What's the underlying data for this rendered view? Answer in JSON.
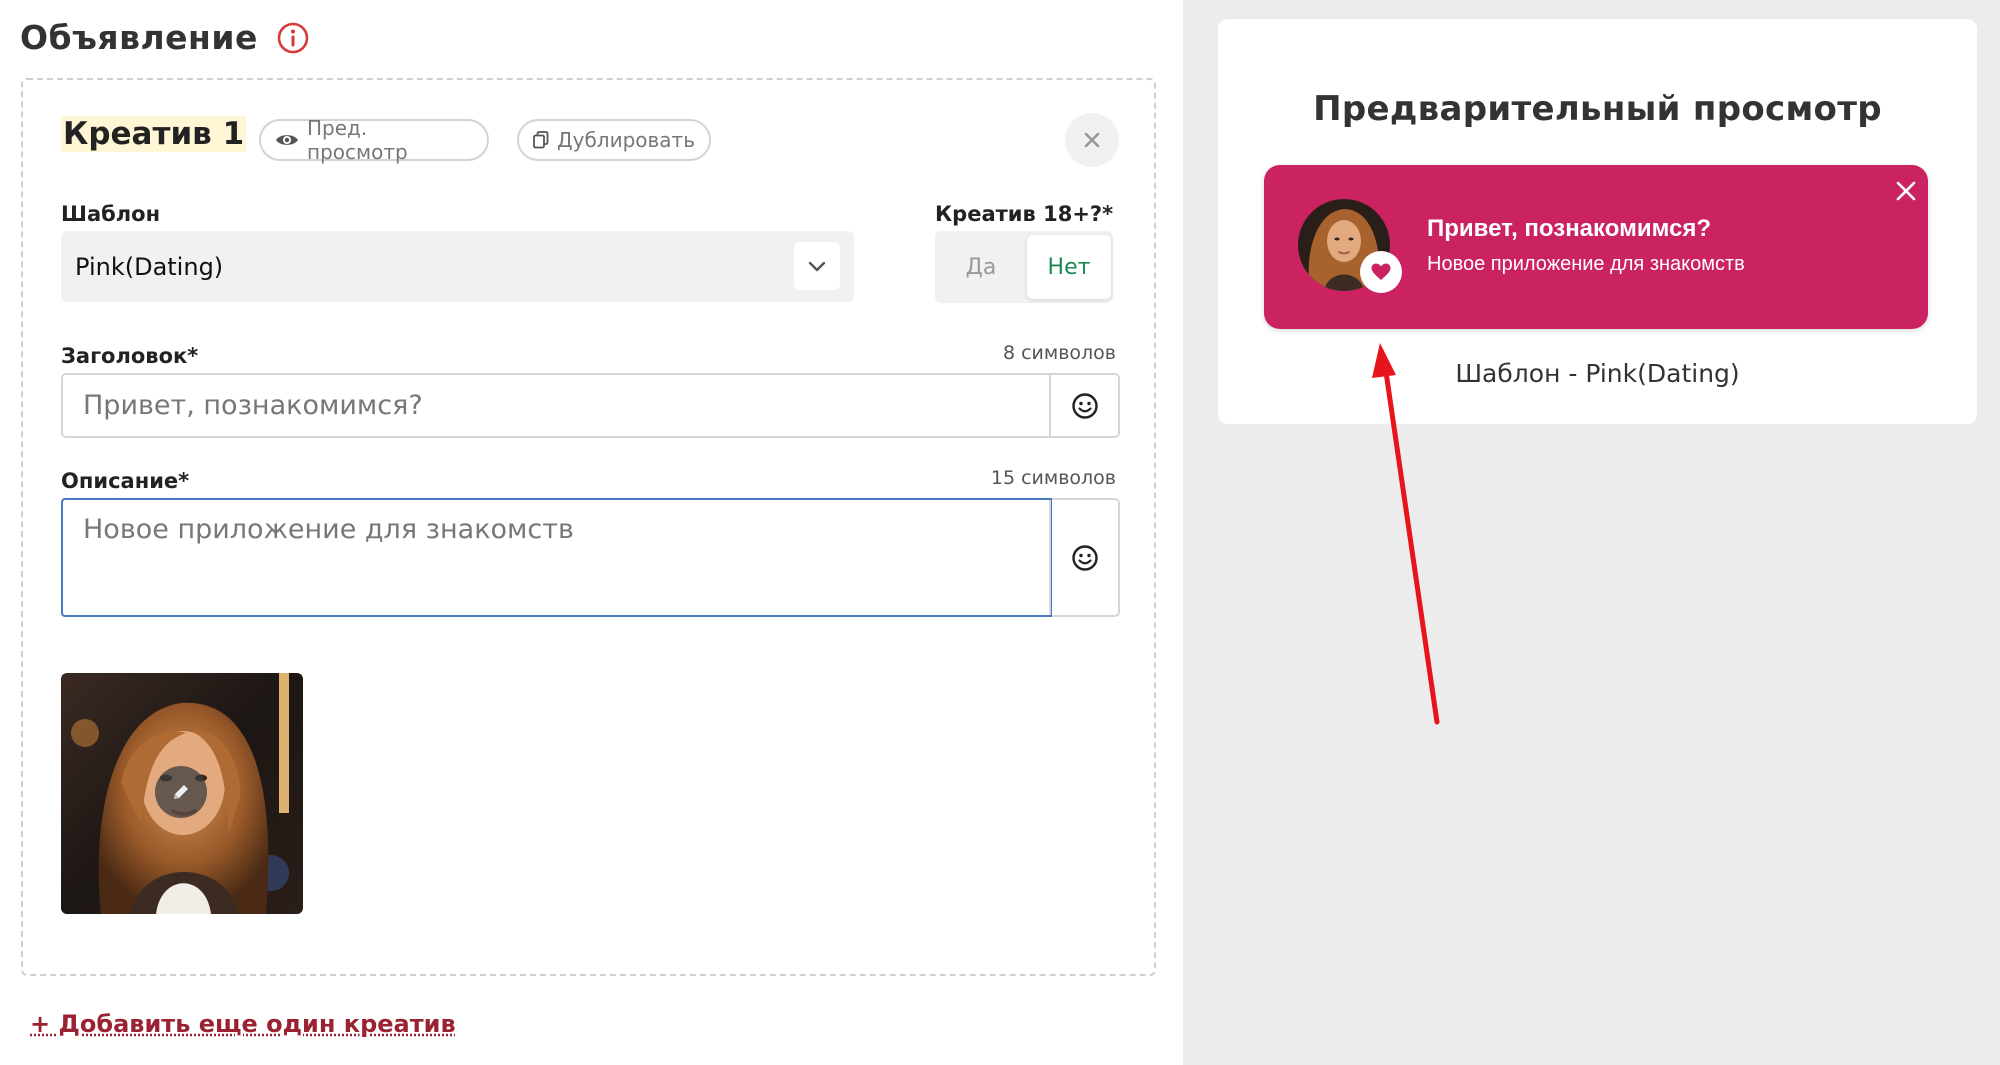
{
  "ad": {
    "title": "Объявление"
  },
  "creative": {
    "title": "Креатив 1",
    "preview_label": "Пред. просмотр",
    "duplicate_label": "Дублировать",
    "template_label": "Шаблон",
    "template_value": "Pink(Dating)",
    "adult_label": "Креатив 18+?*",
    "adult_yes": "Да",
    "adult_no": "Нет",
    "adult_selected": "Нет",
    "headline_label": "Заголовок*",
    "headline_counter": "8 символов",
    "headline_value": "Привет, познакомимся?",
    "description_label": "Описание*",
    "description_counter": "15 символов",
    "description_value": "Новое приложение для знакомств"
  },
  "add_creative_label": "+ Добавить еще один креатив",
  "preview": {
    "title": "Предварительный просмотр",
    "notification_title": "Привет, познакомимся?",
    "notification_text": "Новое приложение для знакомств",
    "caption": "Шаблон - Pink(Dating)"
  },
  "colors": {
    "notification_bg": "#cb2362",
    "link_color": "#9b2232",
    "toggle_active": "#1c8a55",
    "info_icon": "#d63a3a",
    "arrow": "#e8141b"
  },
  "icons": {
    "info": "info-circle-icon",
    "eye": "eye-icon",
    "copy": "copy-icon",
    "close": "close-icon",
    "chevron": "chevron-down-icon",
    "emoji": "smiley-icon",
    "pencil": "pencil-icon",
    "heart": "heart-icon"
  }
}
